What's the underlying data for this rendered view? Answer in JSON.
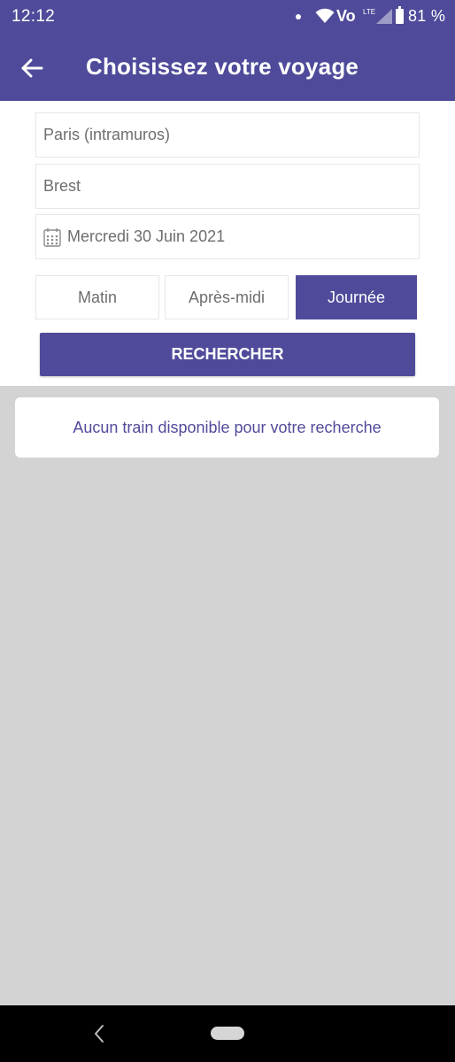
{
  "status_bar": {
    "time": "12:12",
    "volte": "Vo",
    "lte": "LTE",
    "battery_percent": "81 %"
  },
  "app_bar": {
    "title": "Choisissez votre voyage",
    "back_icon": "arrow-left-icon"
  },
  "form": {
    "origin_value": "Paris (intramuros)",
    "destination_value": "Brest",
    "date_value": "Mercredi 30 Juin 2021",
    "date_icon": "calendar-icon",
    "time_segments": [
      {
        "label": "Matin",
        "active": false
      },
      {
        "label": "Après-midi",
        "active": false
      },
      {
        "label": "Journée",
        "active": true
      }
    ],
    "search_label": "RECHERCHER"
  },
  "results": {
    "empty_message": "Aucun train disponible pour votre recherche"
  },
  "colors": {
    "primary": "#4f4b9a",
    "background": "#d3d3d3",
    "field_text": "#6e6e6e"
  }
}
